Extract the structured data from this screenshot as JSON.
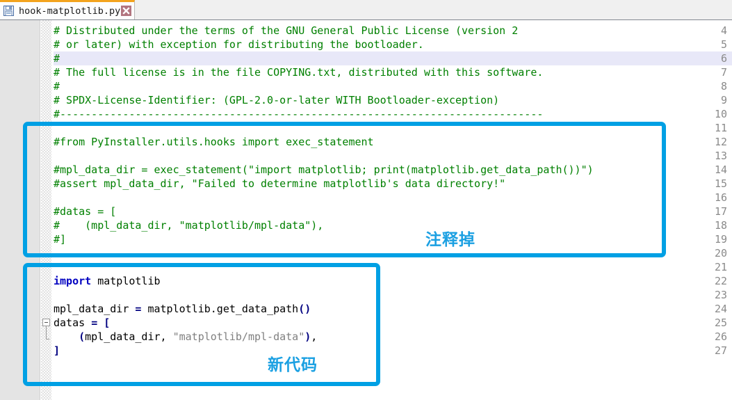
{
  "tab": {
    "filename": "hook-matplotlib.py",
    "save_icon": "floppy-disk-icon",
    "close_icon": "close-icon",
    "accent_color": "#f3a31d"
  },
  "editor": {
    "first_line_number": 4,
    "highlighted_line": 6,
    "comment_color": "#008000",
    "keyword_color": "#0000c0",
    "string_color": "#808080",
    "line_numbers": [
      4,
      5,
      6,
      7,
      8,
      9,
      10,
      11,
      12,
      13,
      14,
      15,
      16,
      17,
      18,
      19,
      20,
      21,
      22,
      23,
      24,
      25,
      26,
      27
    ],
    "lines": [
      {
        "n": 4,
        "text": "# Distributed under the terms of the GNU General Public License (version 2"
      },
      {
        "n": 5,
        "text": "# or later) with exception for distributing the bootloader."
      },
      {
        "n": 6,
        "text": "#"
      },
      {
        "n": 7,
        "text": "# The full license is in the file COPYING.txt, distributed with this software."
      },
      {
        "n": 8,
        "text": "#"
      },
      {
        "n": 9,
        "text": "# SPDX-License-Identifier: (GPL-2.0-or-later WITH Bootloader-exception)"
      },
      {
        "n": 10,
        "text": "#-----------------------------------------------------------------------------"
      },
      {
        "n": 11,
        "text": ""
      },
      {
        "n": 12,
        "text": "#from PyInstaller.utils.hooks import exec_statement"
      },
      {
        "n": 13,
        "text": ""
      },
      {
        "n": 14,
        "text": "#mpl_data_dir = exec_statement(\"import matplotlib; print(matplotlib.get_data_path())\")"
      },
      {
        "n": 15,
        "text": "#assert mpl_data_dir, \"Failed to determine matplotlib's data directory!\""
      },
      {
        "n": 16,
        "text": ""
      },
      {
        "n": 17,
        "text": "#datas = ["
      },
      {
        "n": 18,
        "text": "#    (mpl_data_dir, \"matplotlib/mpl-data\"),"
      },
      {
        "n": 19,
        "text": "#]"
      },
      {
        "n": 20,
        "text": ""
      },
      {
        "n": 21,
        "text": ""
      },
      {
        "n": 22,
        "text": "import matplotlib"
      },
      {
        "n": 23,
        "text": ""
      },
      {
        "n": 24,
        "text": "mpl_data_dir = matplotlib.get_data_path()"
      },
      {
        "n": 25,
        "text": "datas = ["
      },
      {
        "n": 26,
        "text": "    (mpl_data_dir, \"matplotlib/mpl-data\"),"
      },
      {
        "n": 27,
        "text": "]"
      }
    ],
    "code_tokens": {
      "l22_kw": "import",
      "l22_rest": " matplotlib",
      "l24_name": "mpl_data_dir ",
      "l24_eq": "=",
      "l24_rest": " matplotlib.get_data_path",
      "l24_parens": "()",
      "l25_name": "datas ",
      "l25_eq": "=",
      "l25_br": " [",
      "l26_open": "    (",
      "l26_args": "mpl_data_dir, ",
      "l26_str": "\"matplotlib/mpl-data\"",
      "l26_close": ")",
      "l26_comma": ",",
      "l27_br": "]"
    },
    "fold_marker": "collapse-fold-icon"
  },
  "annotations": [
    {
      "id": "commented-out",
      "label": "注释掉",
      "color": "#00a0e4"
    },
    {
      "id": "new-code",
      "label": "新代码",
      "color": "#00a0e4"
    }
  ]
}
